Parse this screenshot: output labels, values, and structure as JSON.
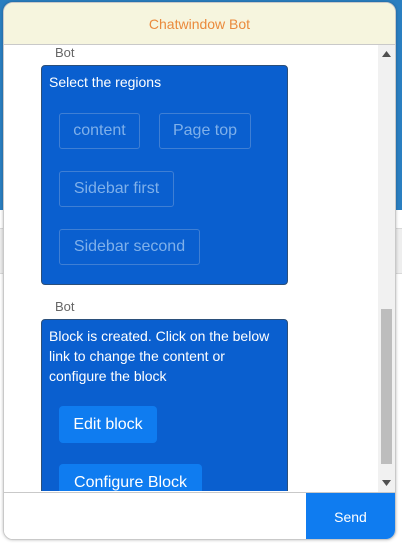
{
  "header": {
    "title": "Chatwindow Bot"
  },
  "messages": [
    {
      "sender": "Bot",
      "text": "Select the regions",
      "options": [
        "content",
        "Page top",
        "Sidebar first",
        "Sidebar second"
      ]
    },
    {
      "sender": "Bot",
      "text": "Block is created. Click on the below link to change the content or configure the block",
      "actions": [
        "Edit block",
        "Configure Block"
      ]
    }
  ],
  "composer": {
    "input_value": "",
    "send_label": "Send"
  },
  "colors": {
    "header_bg": "#f6f5de",
    "header_text": "#ea8a3c",
    "bubble_bg": "#0a5fcf",
    "action_button_bg": "#0f7cf0",
    "send_button_bg": "#0f7cf0"
  },
  "icons": {
    "scroll_up": "triangle-up-icon",
    "scroll_down": "triangle-down-icon"
  }
}
